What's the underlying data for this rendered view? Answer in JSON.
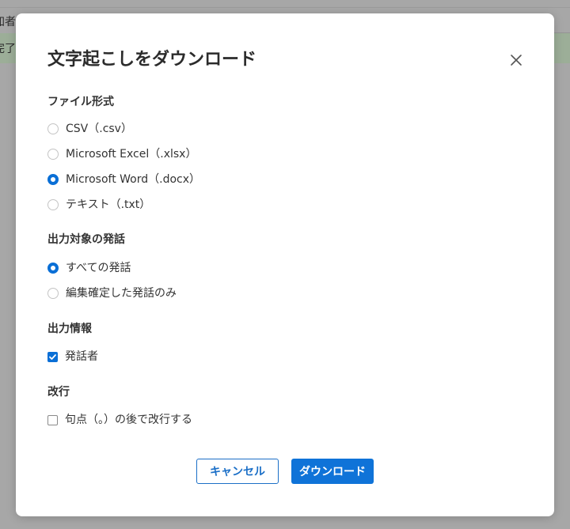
{
  "background": {
    "row1_text": "加者",
    "row2_text": "完了"
  },
  "dialog": {
    "title": "文字起こしをダウンロード",
    "close_icon": "close-icon",
    "sections": {
      "file_format": {
        "title": "ファイル形式",
        "options": [
          {
            "label": "CSV（.csv）",
            "checked": false
          },
          {
            "label": "Microsoft Excel（.xlsx）",
            "checked": false
          },
          {
            "label": "Microsoft Word（.docx）",
            "checked": true
          },
          {
            "label": "テキスト（.txt）",
            "checked": false
          }
        ]
      },
      "target": {
        "title": "出力対象の発話",
        "options": [
          {
            "label": "すべての発話",
            "checked": true
          },
          {
            "label": "編集確定した発話のみ",
            "checked": false
          }
        ]
      },
      "output_info": {
        "title": "出力情報",
        "options": [
          {
            "label": "発話者",
            "checked": true
          }
        ]
      },
      "line_break": {
        "title": "改行",
        "options": [
          {
            "label": "句点（。）の後で改行する",
            "checked": false
          }
        ]
      }
    },
    "buttons": {
      "cancel": "キャンセル",
      "download": "ダウンロード"
    }
  },
  "colors": {
    "accent": "#0a6fd6",
    "overlay": "#a7a7a7"
  }
}
